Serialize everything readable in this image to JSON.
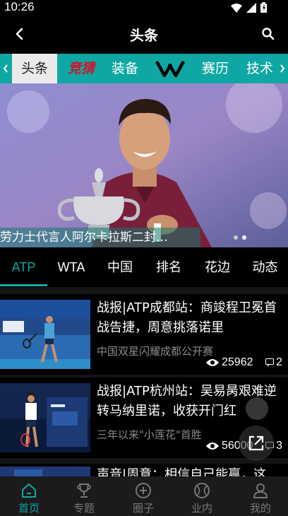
{
  "status_bar": {
    "time": "10:26"
  },
  "header": {
    "title": "头条"
  },
  "categories": [
    {
      "label": "头条",
      "active": true
    },
    {
      "label": "竞猜",
      "style": "logo-red"
    },
    {
      "label": "装备"
    },
    {
      "label": "YONEX",
      "style": "logo"
    },
    {
      "label": "赛历"
    },
    {
      "label": "技术"
    }
  ],
  "banner": {
    "caption": "劳力士代言人阿尔卡拉斯二封…",
    "dots": 2,
    "active_dot": 1
  },
  "subtabs": [
    {
      "label": "ATP",
      "active": true
    },
    {
      "label": "WTA"
    },
    {
      "label": "中国"
    },
    {
      "label": "排名"
    },
    {
      "label": "花边"
    },
    {
      "label": "动态"
    }
  ],
  "articles": [
    {
      "title": "战报|ATP成都站：商竣程卫冕首战告捷，周意挑落诺里",
      "subtitle": "中国双星闪耀成都公开赛",
      "views": "25962",
      "comments": "2"
    },
    {
      "title": "战报|ATP杭州站：吴易昺艰难逆转马纳里诺，收获开门红",
      "subtitle": "三年以来\"小莲花\"首胜",
      "views": "56000",
      "comments": "3"
    },
    {
      "title": "声音|周意：相信自己能赢，这"
    }
  ],
  "bottom_nav": [
    {
      "label": "首页",
      "icon": "home-icon",
      "active": true
    },
    {
      "label": "专题",
      "icon": "trophy-icon"
    },
    {
      "label": "圈子",
      "icon": "plus-circle-icon"
    },
    {
      "label": "业内",
      "icon": "tennis-ball-icon"
    },
    {
      "label": "我的",
      "icon": "user-icon"
    }
  ],
  "colors": {
    "accent": "#10a8a4",
    "category_bar": "#0fa7a3",
    "background": "#000000"
  }
}
